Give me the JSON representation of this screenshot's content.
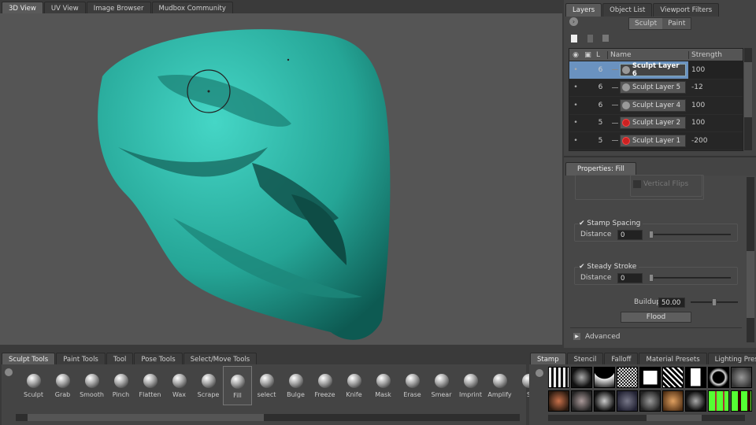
{
  "view_tabs": [
    "3D View",
    "UV View",
    "Image Browser",
    "Mudbox Community"
  ],
  "right_tabs": [
    "Layers",
    "Object List",
    "Viewport Filters"
  ],
  "layer_mode": [
    "Sculpt",
    "Paint"
  ],
  "layer_columns": {
    "visible": "",
    "lock": "",
    "level": "L",
    "name": "Name",
    "strength": "Strength"
  },
  "layers": [
    {
      "level": "6",
      "name": "Sculpt Layer 6",
      "strength": "100",
      "selected": true,
      "icon": "hand"
    },
    {
      "level": "6",
      "name": "Sculpt Layer 5",
      "strength": "-12",
      "icon": "hand"
    },
    {
      "level": "6",
      "name": "Sculpt Layer 4",
      "strength": "100",
      "icon": "hand"
    },
    {
      "level": "5",
      "name": "Sculpt Layer 2",
      "strength": "100",
      "icon": "red"
    },
    {
      "level": "5",
      "name": "Sculpt Layer 1",
      "strength": "-200",
      "icon": "red"
    }
  ],
  "properties": {
    "tab": "Properties: Fill",
    "vertical_flips": "Vertical Flips",
    "stamp_spacing": "Stamp Spacing",
    "stamp_spacing_checked": true,
    "distance_label": "Distance",
    "stamp_distance": "0",
    "steady_stroke": "Steady Stroke",
    "steady_stroke_checked": true,
    "steady_distance": "0",
    "buildup_label": "Buildup",
    "buildup": "50.00",
    "flood": "Flood",
    "advanced": "Advanced"
  },
  "tool_tabs": [
    "Sculpt Tools",
    "Paint Tools",
    "Tool",
    "Pose Tools",
    "Select/Move Tools"
  ],
  "tools": [
    "Sculpt",
    "Grab",
    "Smooth",
    "Pinch",
    "Flatten",
    "Wax",
    "Scrape",
    "Fill",
    "select",
    "Bulge",
    "Freeze",
    "Knife",
    "Mask",
    "Erase",
    "Smear",
    "Imprint",
    "Amplify",
    "S"
  ],
  "selected_tool": "Fill",
  "stamp_tabs": [
    "Stamp",
    "Stencil",
    "Falloff",
    "Material Presets",
    "Lighting Presets"
  ],
  "colors": {
    "model": "#2fb3a6",
    "viewport": "#555555",
    "selection": "#6a92c0"
  }
}
